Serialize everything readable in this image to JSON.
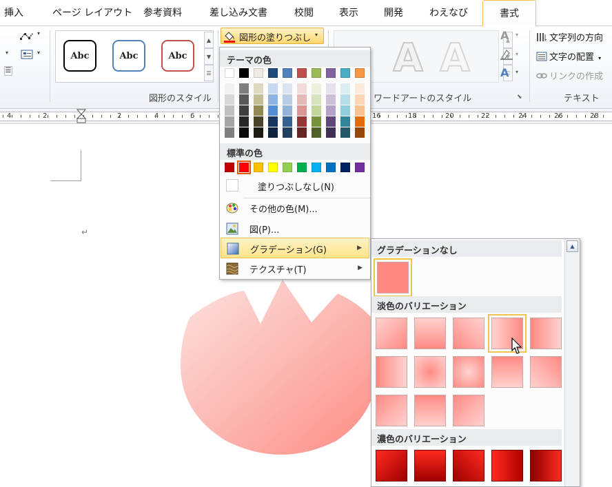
{
  "tabs": [
    "挿入",
    "ページ レイアウト",
    "参考資料",
    "差し込み文書",
    "校閲",
    "表示",
    "開発",
    "わえなび",
    "書式"
  ],
  "ribbon": {
    "shape_style_label": "Abc",
    "shape_styles_group": "図形のスタイル",
    "wordart_group": "ワードアートのスタイル",
    "wordart_letter": "A",
    "text_group": "テキスト",
    "text_direction": "文字列の方向",
    "text_align": "文字の配置",
    "create_link": "リンクの作成",
    "fill_button": "図形の塗りつぶし",
    "dropdown_arrow": "▾",
    "dialog_launcher": "⬊",
    "gallery_up": "▲",
    "gallery_down": "▼",
    "gallery_more": "☰"
  },
  "ruler_numbers": [
    "4",
    "2",
    "2",
    "4",
    "6",
    "16",
    "18",
    "20",
    "22",
    "24",
    "26",
    "28"
  ],
  "paragraph_mark": "↵",
  "fill_menu": {
    "theme_header": "テーマの色",
    "standard_header": "標準の色",
    "no_fill": "塗りつぶしなし(N)",
    "more_colors": "その他の色(M)...",
    "picture": "図(P)...",
    "gradient": "グラデーション(G)",
    "texture": "テクスチャ(T)",
    "submenu_arrow": "▶",
    "theme_top_row": [
      "#ffffff",
      "#000000",
      "#eeece1",
      "#1f497d",
      "#4f81bd",
      "#c0504d",
      "#9bbb59",
      "#8064a2",
      "#4bacc6",
      "#f79646"
    ],
    "theme_shades": [
      [
        "#f2f2f2",
        "#d8d8d8",
        "#bfbfbf",
        "#a5a5a5",
        "#7f7f7f"
      ],
      [
        "#7f7f7f",
        "#595959",
        "#3f3f3f",
        "#262626",
        "#0c0c0c"
      ],
      [
        "#ddd9c3",
        "#c4bd97",
        "#938953",
        "#494429",
        "#1d1b10"
      ],
      [
        "#c6d9f0",
        "#8db3e2",
        "#548dd4",
        "#17365d",
        "#0f243e"
      ],
      [
        "#dbe5f1",
        "#b8cce4",
        "#95b3d7",
        "#366092",
        "#244061"
      ],
      [
        "#f2dcdb",
        "#e5b9b7",
        "#d99694",
        "#953734",
        "#632423"
      ],
      [
        "#ebf1dd",
        "#d7e3bc",
        "#c3d69b",
        "#76923c",
        "#4f6128"
      ],
      [
        "#e5e0ec",
        "#ccc1d9",
        "#b2a2c7",
        "#5f497a",
        "#3f3151"
      ],
      [
        "#dbeef3",
        "#b7dde8",
        "#92cddc",
        "#31859b",
        "#205867"
      ],
      [
        "#fdeada",
        "#fbd5b5",
        "#fac08f",
        "#e36c09",
        "#974806"
      ]
    ],
    "standard_colors": [
      "#c00000",
      "#ff0000",
      "#ffc000",
      "#ffff00",
      "#92d050",
      "#00b050",
      "#00b0f0",
      "#0070c0",
      "#002060",
      "#7030a0"
    ],
    "selected_standard_color": "#ff0000"
  },
  "gradient_menu": {
    "none_header": "グラデーションなし",
    "light_header": "淡色のバリエーション",
    "dark_header": "濃色のバリエーション",
    "scroll_up": "▲",
    "base_color": "#ff8a84"
  }
}
